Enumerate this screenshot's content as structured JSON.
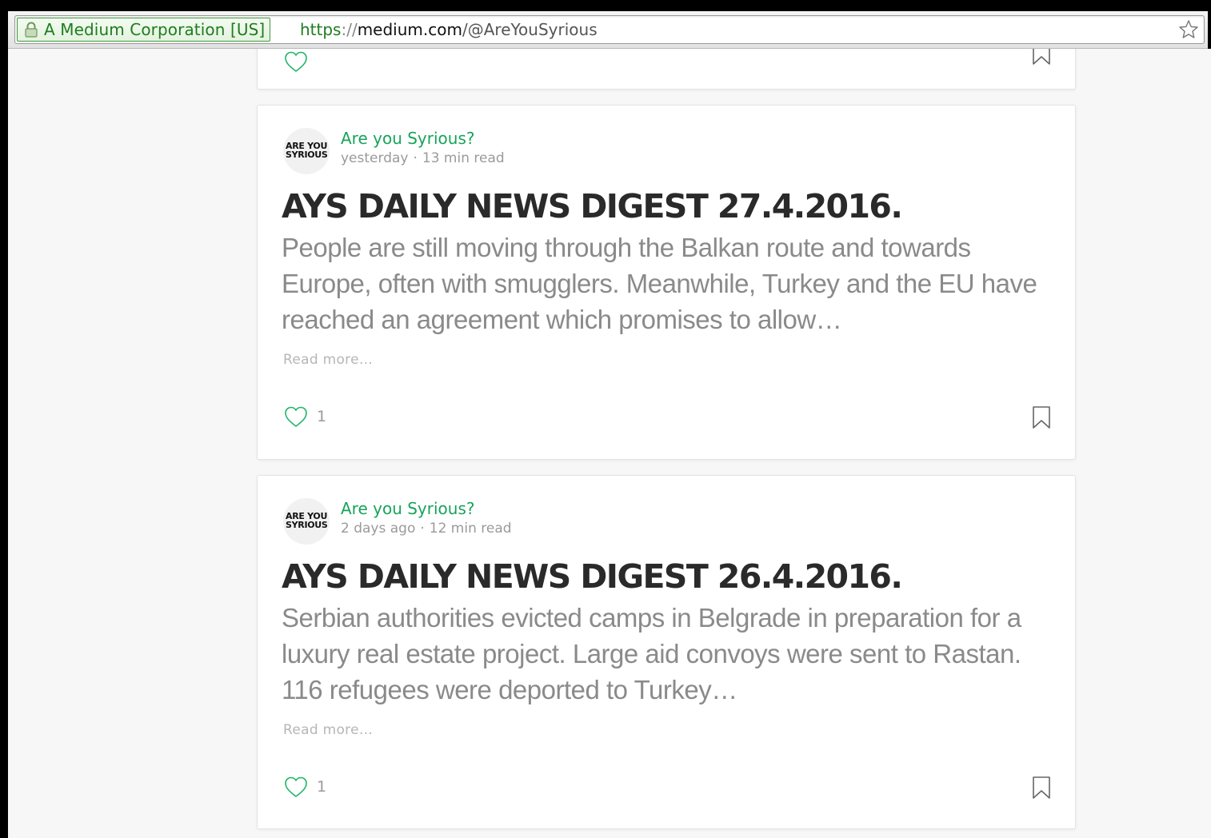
{
  "browser": {
    "ev_label": "A Medium Corporation [US]",
    "url_scheme": "https",
    "url_sep": "://",
    "url_host": "medium.com",
    "url_path": "/@AreYouSyrious"
  },
  "posts": [
    {
      "author": "Are you Syrious?",
      "avatar_line1": "ARE YOU",
      "avatar_line2": "SYRIOUS",
      "time": "yesterday",
      "read_time": "13 min read",
      "dot": "·",
      "title": "AYS DAILY NEWS DIGEST 27.4.2016.",
      "excerpt": "People are still moving through the Balkan route and towards Europe, often with smugglers. Meanwhile, Turkey and the EU have reached an agreement which promises to allow…",
      "read_more": "Read more…",
      "likes": "1"
    },
    {
      "author": "Are you Syrious?",
      "avatar_line1": "ARE YOU",
      "avatar_line2": "SYRIOUS",
      "time": "2 days ago",
      "read_time": "12 min read",
      "dot": "·",
      "title": "AYS DAILY NEWS DIGEST 26.4.2016.",
      "excerpt": "Serbian authorities evicted camps in Belgrade in preparation for a luxury real estate project. Large aid convoys were sent to Rastan. 116 refugees were deported to Turkey…",
      "read_more": "Read more…",
      "likes": "1"
    }
  ],
  "colors": {
    "accent_green": "#18a35a",
    "ev_green": "#1f7c1f"
  },
  "icons": {
    "lock": "lock-icon",
    "star": "star-icon",
    "heart": "heart-icon",
    "bookmark": "bookmark-icon"
  }
}
